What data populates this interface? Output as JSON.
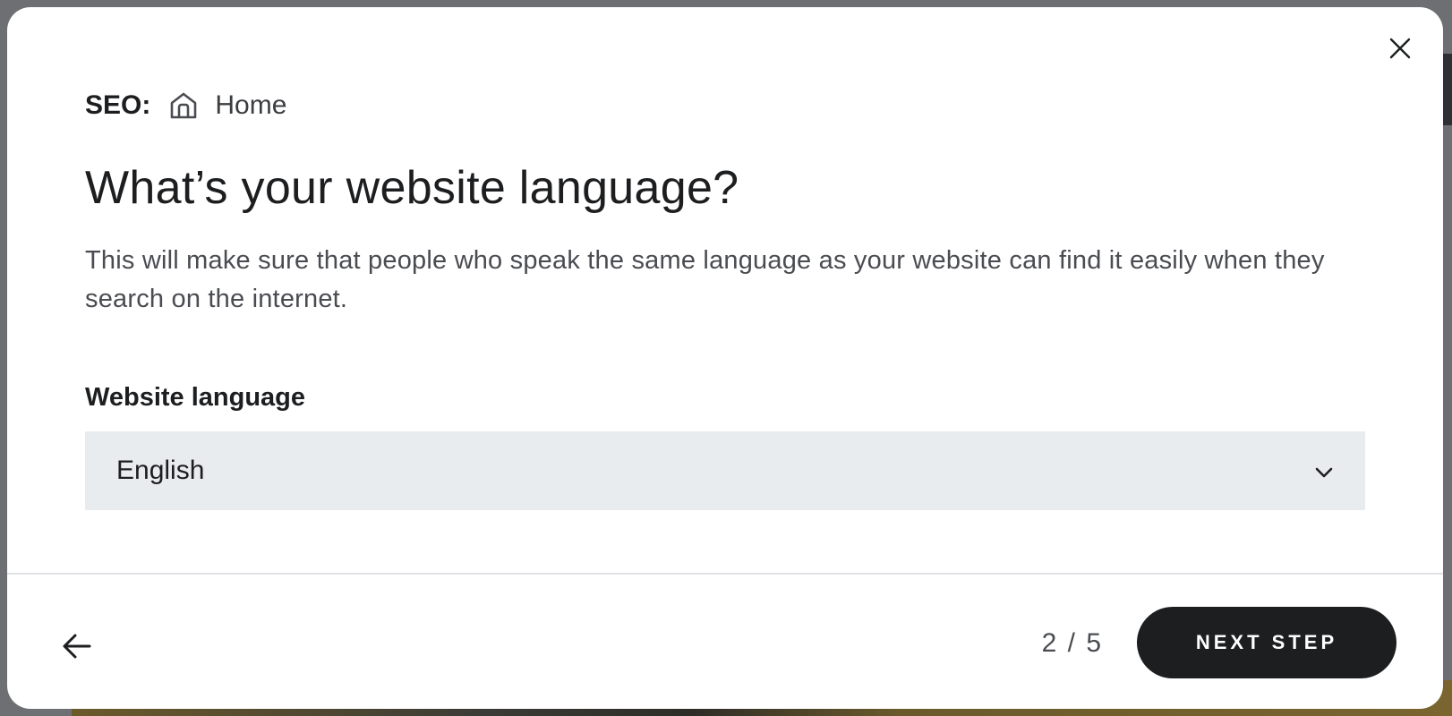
{
  "breadcrumb": {
    "prefix": "SEO:",
    "page_icon": "home-icon",
    "page_name": "Home"
  },
  "title": "What’s your website language?",
  "description": "This will make sure that people who speak the same language as your website can find it easily when they search on the internet.",
  "language_field": {
    "label": "Website language",
    "selected": "English"
  },
  "footer": {
    "step_counter": "2 / 5",
    "next_label": "NEXT STEP"
  },
  "colors": {
    "primary_button": "#1d1e20",
    "select_background": "#e9ecef",
    "text_primary": "#1d1e20",
    "text_secondary": "#4a4c51"
  },
  "icons": {
    "close": "close-icon",
    "dropdown": "chevron-down-icon",
    "back": "arrow-left-icon"
  }
}
